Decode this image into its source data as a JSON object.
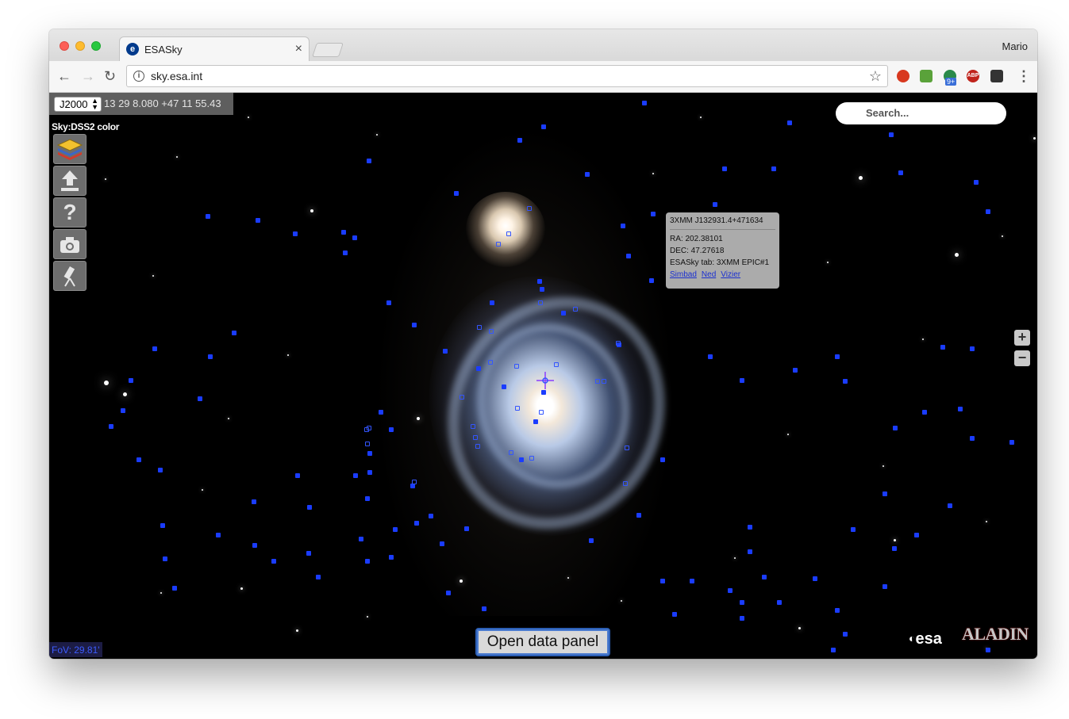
{
  "browser": {
    "tab_title": "ESASky",
    "tab_close": "×",
    "user_name": "Mario",
    "url": "sky.esa.int",
    "nav": {
      "back": "←",
      "forward": "→",
      "reload": "↻"
    },
    "star_icon": "☆",
    "info_icon": "i",
    "extensions": [
      {
        "name": "ublock-icon",
        "color": "#d8381f",
        "label": ""
      },
      {
        "name": "evernote-web-clipper-icon",
        "color": "#5aa23a",
        "label": ""
      },
      {
        "name": "profile-badge-icon",
        "color": "#2a8a4a",
        "label": "9+"
      },
      {
        "name": "adblock-plus-icon",
        "color": "#c0241c",
        "label": "ABP"
      },
      {
        "name": "puzzle-extension-icon",
        "color": "#333333",
        "label": ""
      }
    ],
    "menu_icon": "⋮"
  },
  "esasky": {
    "coordinate_frame": "J2000",
    "coordinates": "13 29 8.080 +47 11 55.43",
    "survey_label": "Sky:DSS2 color",
    "search_placeholder": "Search...",
    "zoom_in": "+",
    "zoom_out": "−",
    "tooltip": {
      "source_name": "3XMM J132931.4+471634",
      "ra": "RA: 202.38101",
      "dec": "DEC: 47.27618",
      "tab": "ESASky tab: 3XMM EPIC#1",
      "links": [
        "Simbad",
        "Ned",
        "Vizier"
      ]
    },
    "open_data_panel": "Open data panel",
    "fov": "FoV: 29.81'",
    "esa_logo": "esa",
    "aladin_logo": "ALADIN",
    "marker_color": "#1a3cff"
  }
}
